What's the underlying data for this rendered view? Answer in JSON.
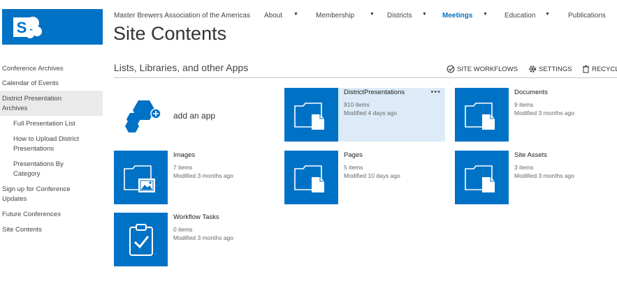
{
  "logo": {
    "letter": "S",
    "brand_color": "#0072c6"
  },
  "nav": {
    "site_name": "Master Brewers Association of the Americas",
    "items": [
      {
        "label": "About"
      },
      {
        "label": "Membership"
      },
      {
        "label": "Districts"
      },
      {
        "label": "Meetings",
        "active": true
      },
      {
        "label": "Education"
      },
      {
        "label": "Publications"
      }
    ]
  },
  "page": {
    "title": "Site Contents"
  },
  "leftnav": {
    "items": [
      {
        "label": "Conference Archives"
      },
      {
        "label": "Calendar of Events"
      },
      {
        "label": "District Presentation Archives",
        "selected": true
      },
      {
        "label": "Full Presentation List"
      },
      {
        "label": "How to Upload District Presentations"
      },
      {
        "label": "Presentations By Category"
      },
      {
        "label": "Sign up for Conference Updates"
      },
      {
        "label": "Future Conferences"
      },
      {
        "label": "Site Contents"
      }
    ]
  },
  "subheader": {
    "title": "Lists, Libraries, and other Apps",
    "site_workflows": "SITE WORKFLOWS",
    "settings": "SETTINGS",
    "recycle": "RECYCL"
  },
  "add_app": {
    "label": "add an app"
  },
  "tiles": [
    {
      "name": "DistrictPresentations",
      "count": "910 items",
      "modified": "Modified 4 days ago",
      "icon": "document-library-icon"
    },
    {
      "name": "Documents",
      "count": "9 items",
      "modified": "Modified 3 months ago",
      "icon": "document-library-icon"
    },
    {
      "name": "Images",
      "count": "7 items",
      "modified": "Modified 3 months ago",
      "icon": "picture-library-icon"
    },
    {
      "name": "Pages",
      "count": "5 items",
      "modified": "Modified 10 days ago",
      "icon": "document-library-icon"
    },
    {
      "name": "Site Assets",
      "count": "3 items",
      "modified": "Modified 3 months ago",
      "icon": "document-library-icon"
    },
    {
      "name": "Workflow Tasks",
      "count": "0 items",
      "modified": "Modified 3 months ago",
      "icon": "task-list-icon"
    }
  ],
  "tile_menu": "•••"
}
